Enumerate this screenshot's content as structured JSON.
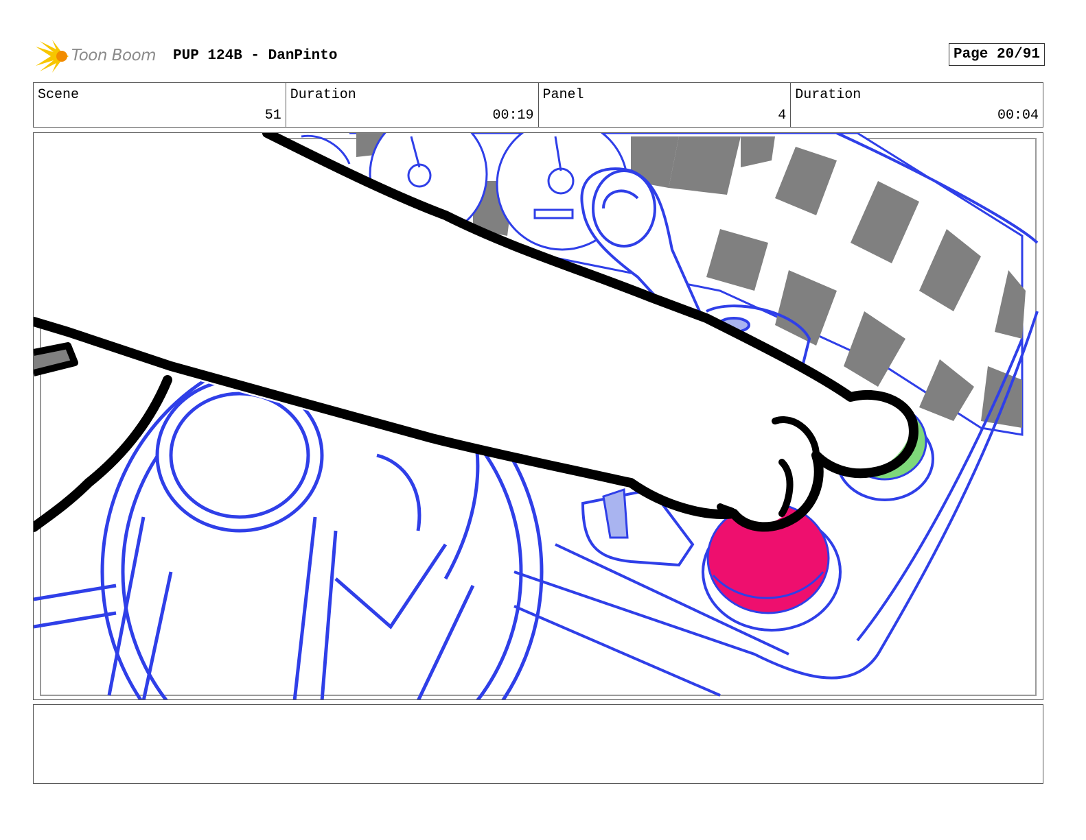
{
  "header": {
    "logo_text": "Toon Boom",
    "title": "PUP 124B - DanPinto",
    "page": "Page 20/91"
  },
  "info": {
    "scene_label": "Scene",
    "scene_value": "51",
    "scene_duration_label": "Duration",
    "scene_duration_value": "00:19",
    "panel_label": "Panel",
    "panel_value": "4",
    "panel_duration_label": "Duration",
    "panel_duration_value": "00:04"
  },
  "colors": {
    "line_blue": "#2f3fe8",
    "ink": "#000000",
    "checker": "#808080",
    "button_red": "#ee0f6e",
    "button_green": "#7ed87a",
    "accent_light_blue": "#a9b4f0",
    "logo_yellow": "#f7c600"
  },
  "notes": {
    "text": ""
  }
}
